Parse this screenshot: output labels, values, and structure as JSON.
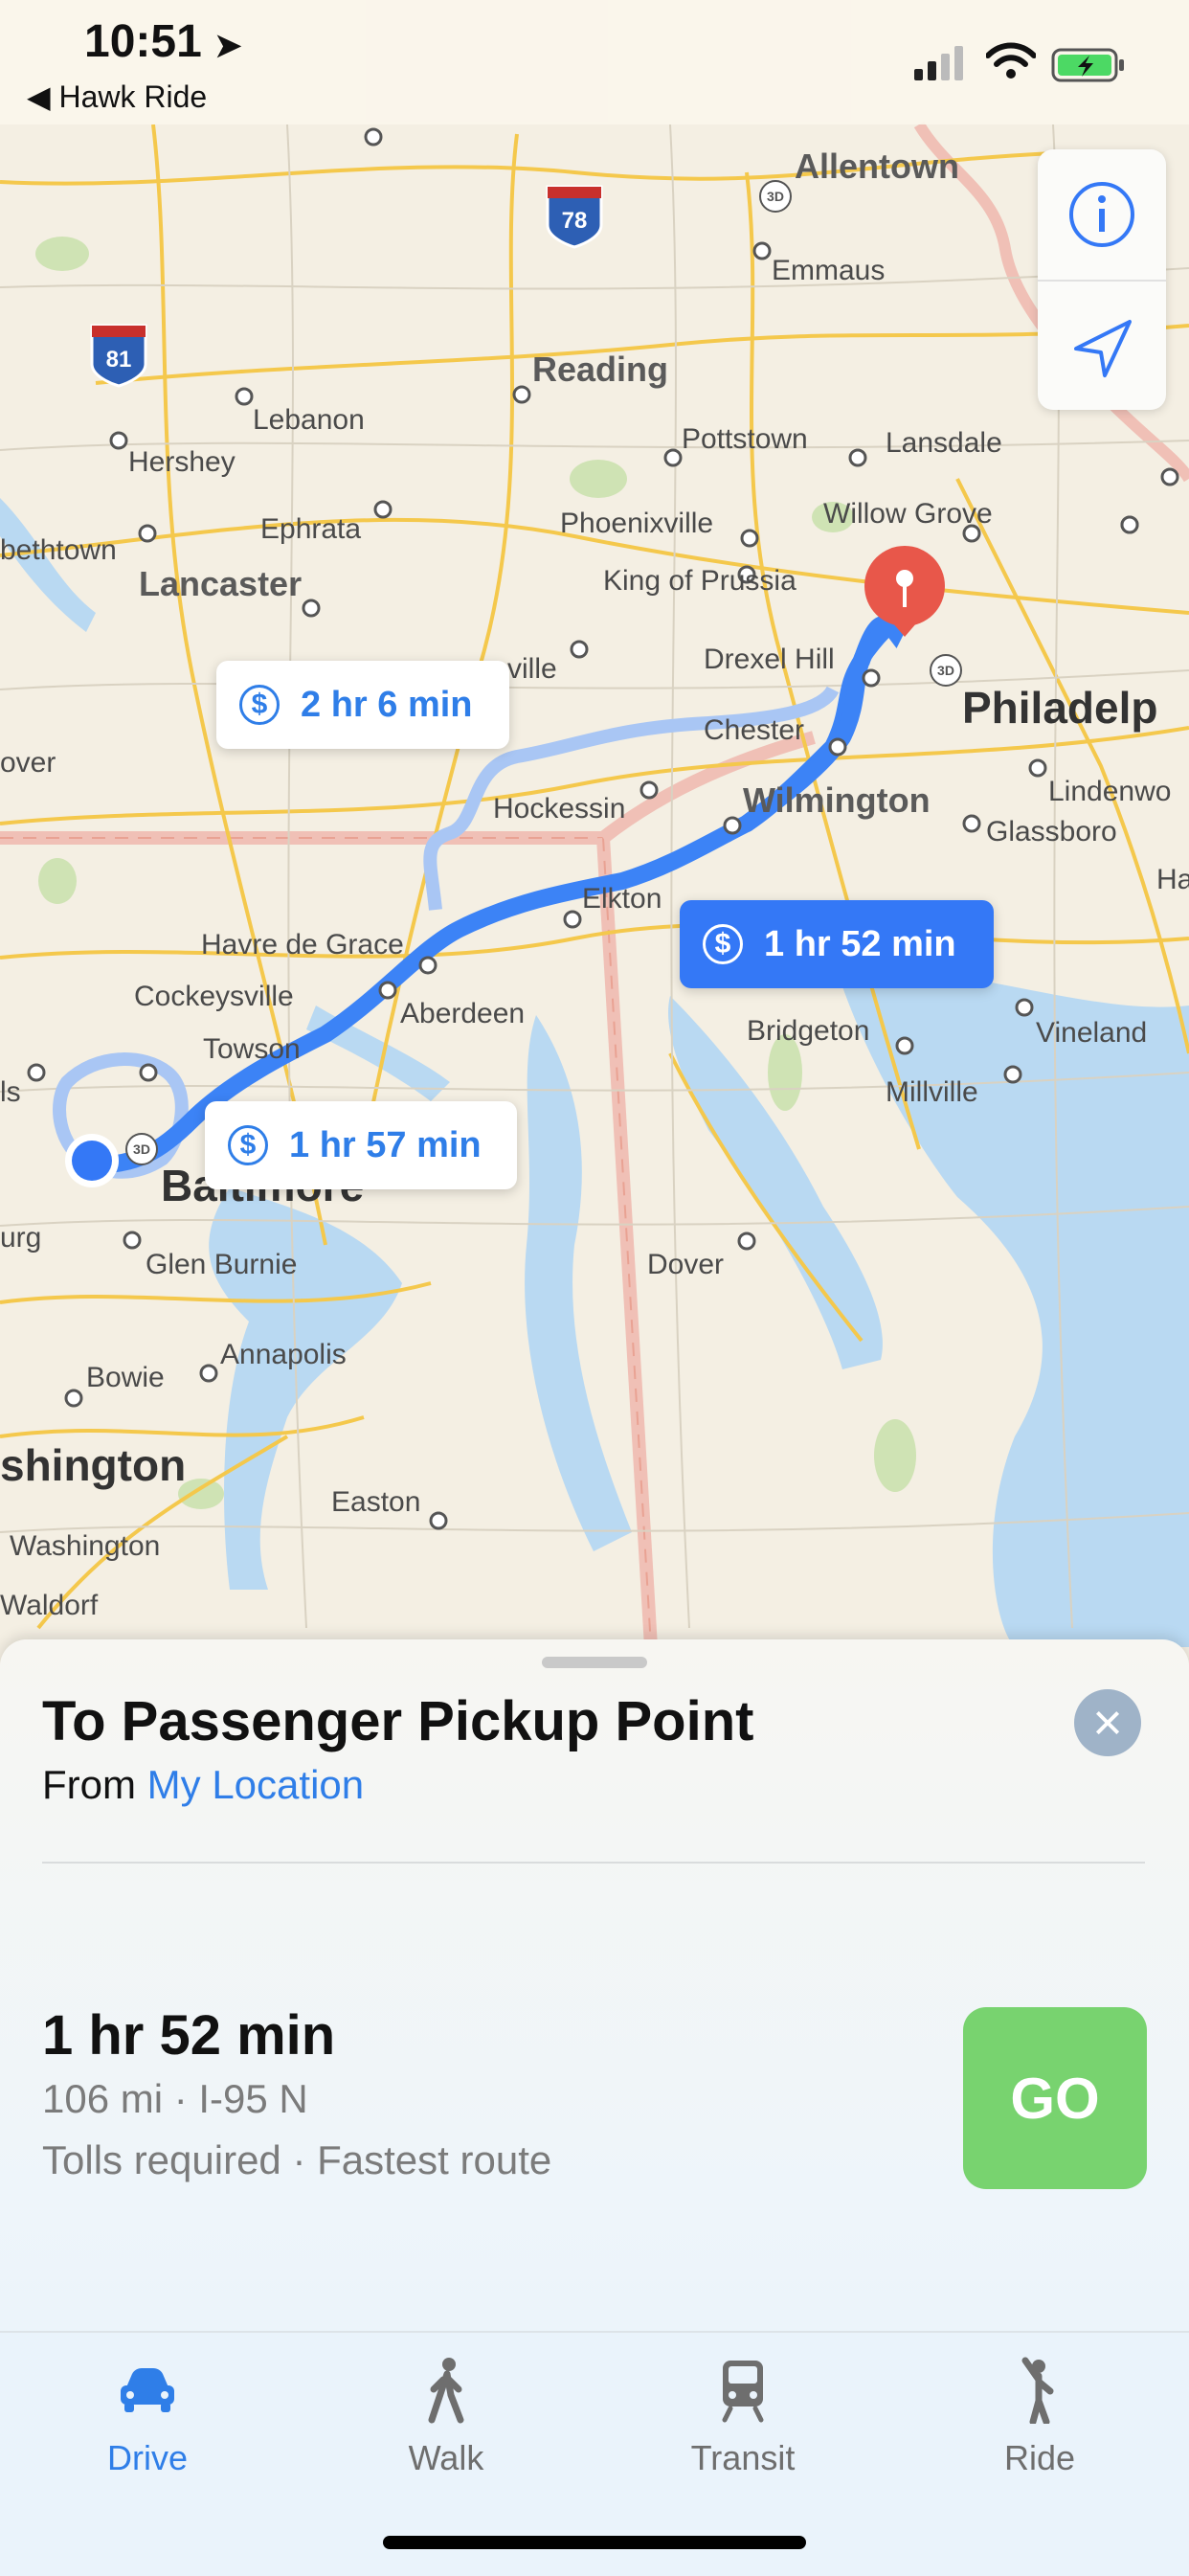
{
  "status_bar": {
    "time": "10:51",
    "back_label": "Hawk Ride"
  },
  "map": {
    "places": [
      "Allentown",
      "Emmaus",
      "Reading",
      "Lebanon",
      "Hershey",
      "Pottstown",
      "Lansdale",
      "Ephrata",
      "Phoenixville",
      "Willow Grove",
      "bethtown",
      "Lancaster",
      "King of Prussia",
      "Drexel Hill",
      "Philadelp",
      "ville",
      "Chester",
      "Lindenwo",
      "over",
      "Hockessin",
      "Wilmington",
      "Glassboro",
      "Elkton",
      "Havre de Grace",
      "Ha",
      "Cockeysville",
      "Aberdeen",
      "Bridgeton",
      "Vineland",
      "Towson",
      "Millville",
      "ls",
      "Baltimore",
      "urg",
      "Glen Burnie",
      "Dover",
      "Annapolis",
      "Bowie",
      "shington",
      "Easton",
      "Washington",
      "Waldorf"
    ],
    "highways": [
      "78",
      "81"
    ],
    "route_bubbles": [
      {
        "label": "2 hr 6 min",
        "active": false
      },
      {
        "label": "1 hr 52 min",
        "active": true
      },
      {
        "label": "1 hr 57 min",
        "active": false
      }
    ],
    "icons": {
      "info": "info-icon",
      "location": "location-arrow-icon",
      "toll": "dollar-icon"
    }
  },
  "sheet": {
    "title": "To Passenger Pickup Point",
    "from_prefix": "From",
    "from_location": "My Location",
    "eta": "1 hr 52 min",
    "distance_route": "106 mi · I-95 N",
    "notes": "Tolls required · Fastest route",
    "go_label": "GO"
  },
  "tabs": [
    {
      "label": "Drive",
      "icon": "car-icon",
      "active": true
    },
    {
      "label": "Walk",
      "icon": "walk-icon",
      "active": false
    },
    {
      "label": "Transit",
      "icon": "train-icon",
      "active": false
    },
    {
      "label": "Ride",
      "icon": "ride-icon",
      "active": false
    }
  ],
  "colors": {
    "accent": "#3478f6",
    "go": "#78d36f",
    "pin": "#e8574a",
    "road": "#f4c84c"
  }
}
